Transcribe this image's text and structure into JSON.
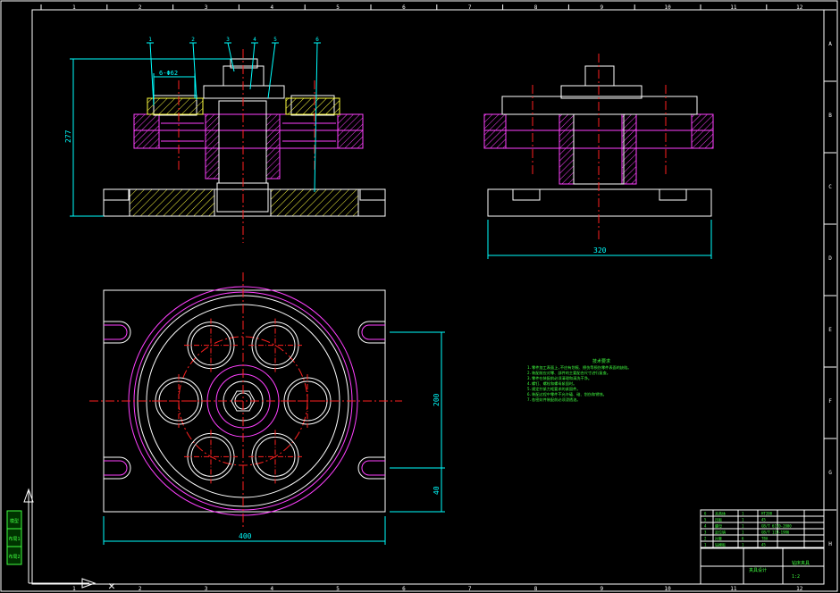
{
  "colors": {
    "background": "#000000",
    "frame": "#ffffff",
    "dimension": "#00ffff",
    "centerline": "#ff2020",
    "section": "#ff40ff",
    "hatch": "#ffff40",
    "green_text": "#40ff40"
  },
  "grid": {
    "columns": [
      "1",
      "2",
      "3",
      "4",
      "5",
      "6",
      "7",
      "8",
      "9",
      "10",
      "11",
      "12"
    ],
    "rows": [
      "A",
      "B",
      "C",
      "D",
      "E",
      "F",
      "G",
      "H"
    ]
  },
  "balloons": [
    "1",
    "2",
    "3",
    "4",
    "5",
    "6"
  ],
  "dimensions": {
    "bolt_circle": "6-Φ62",
    "height": "277",
    "side_width": "320",
    "plan_width": "400",
    "slot_spacing": "200",
    "edge_offset": "40"
  },
  "notes": {
    "title": "技术要求",
    "lines": [
      "1.零件加工表面上,不应有划痕、擦伤等损伤零件表面的缺陷。",
      "2.装配前应对零、部件的主要配合尺寸进行复查。",
      "3.零件在装配前必须清理和清洗干净。",
      "4.螺钉、螺栓和螺母紧固时。",
      "5.规定拧紧力矩要求的紧固件。",
      "6.装配过程中零件不允许磕、碰、划伤和锈蚀。",
      "7.各密封件装配前必须浸透油。"
    ]
  },
  "title_block": {
    "parts": [
      [
        "6",
        "夹具体",
        "1",
        "HT200"
      ],
      [
        "5",
        "压板",
        "1",
        "45"
      ],
      [
        "4",
        "螺母",
        "1",
        "GB/T 6170-2000"
      ],
      [
        "3",
        "定位销",
        "1",
        "GB/T 119-1986"
      ],
      [
        "2",
        "衬套",
        "6",
        "T8A"
      ],
      [
        "1",
        "钻模板",
        "1",
        "45"
      ]
    ],
    "drawing_name": "钻床夹具",
    "school": "夹具设计",
    "scale": "1:2"
  },
  "toolbar": [
    "模型",
    "布局1",
    "布局2"
  ]
}
